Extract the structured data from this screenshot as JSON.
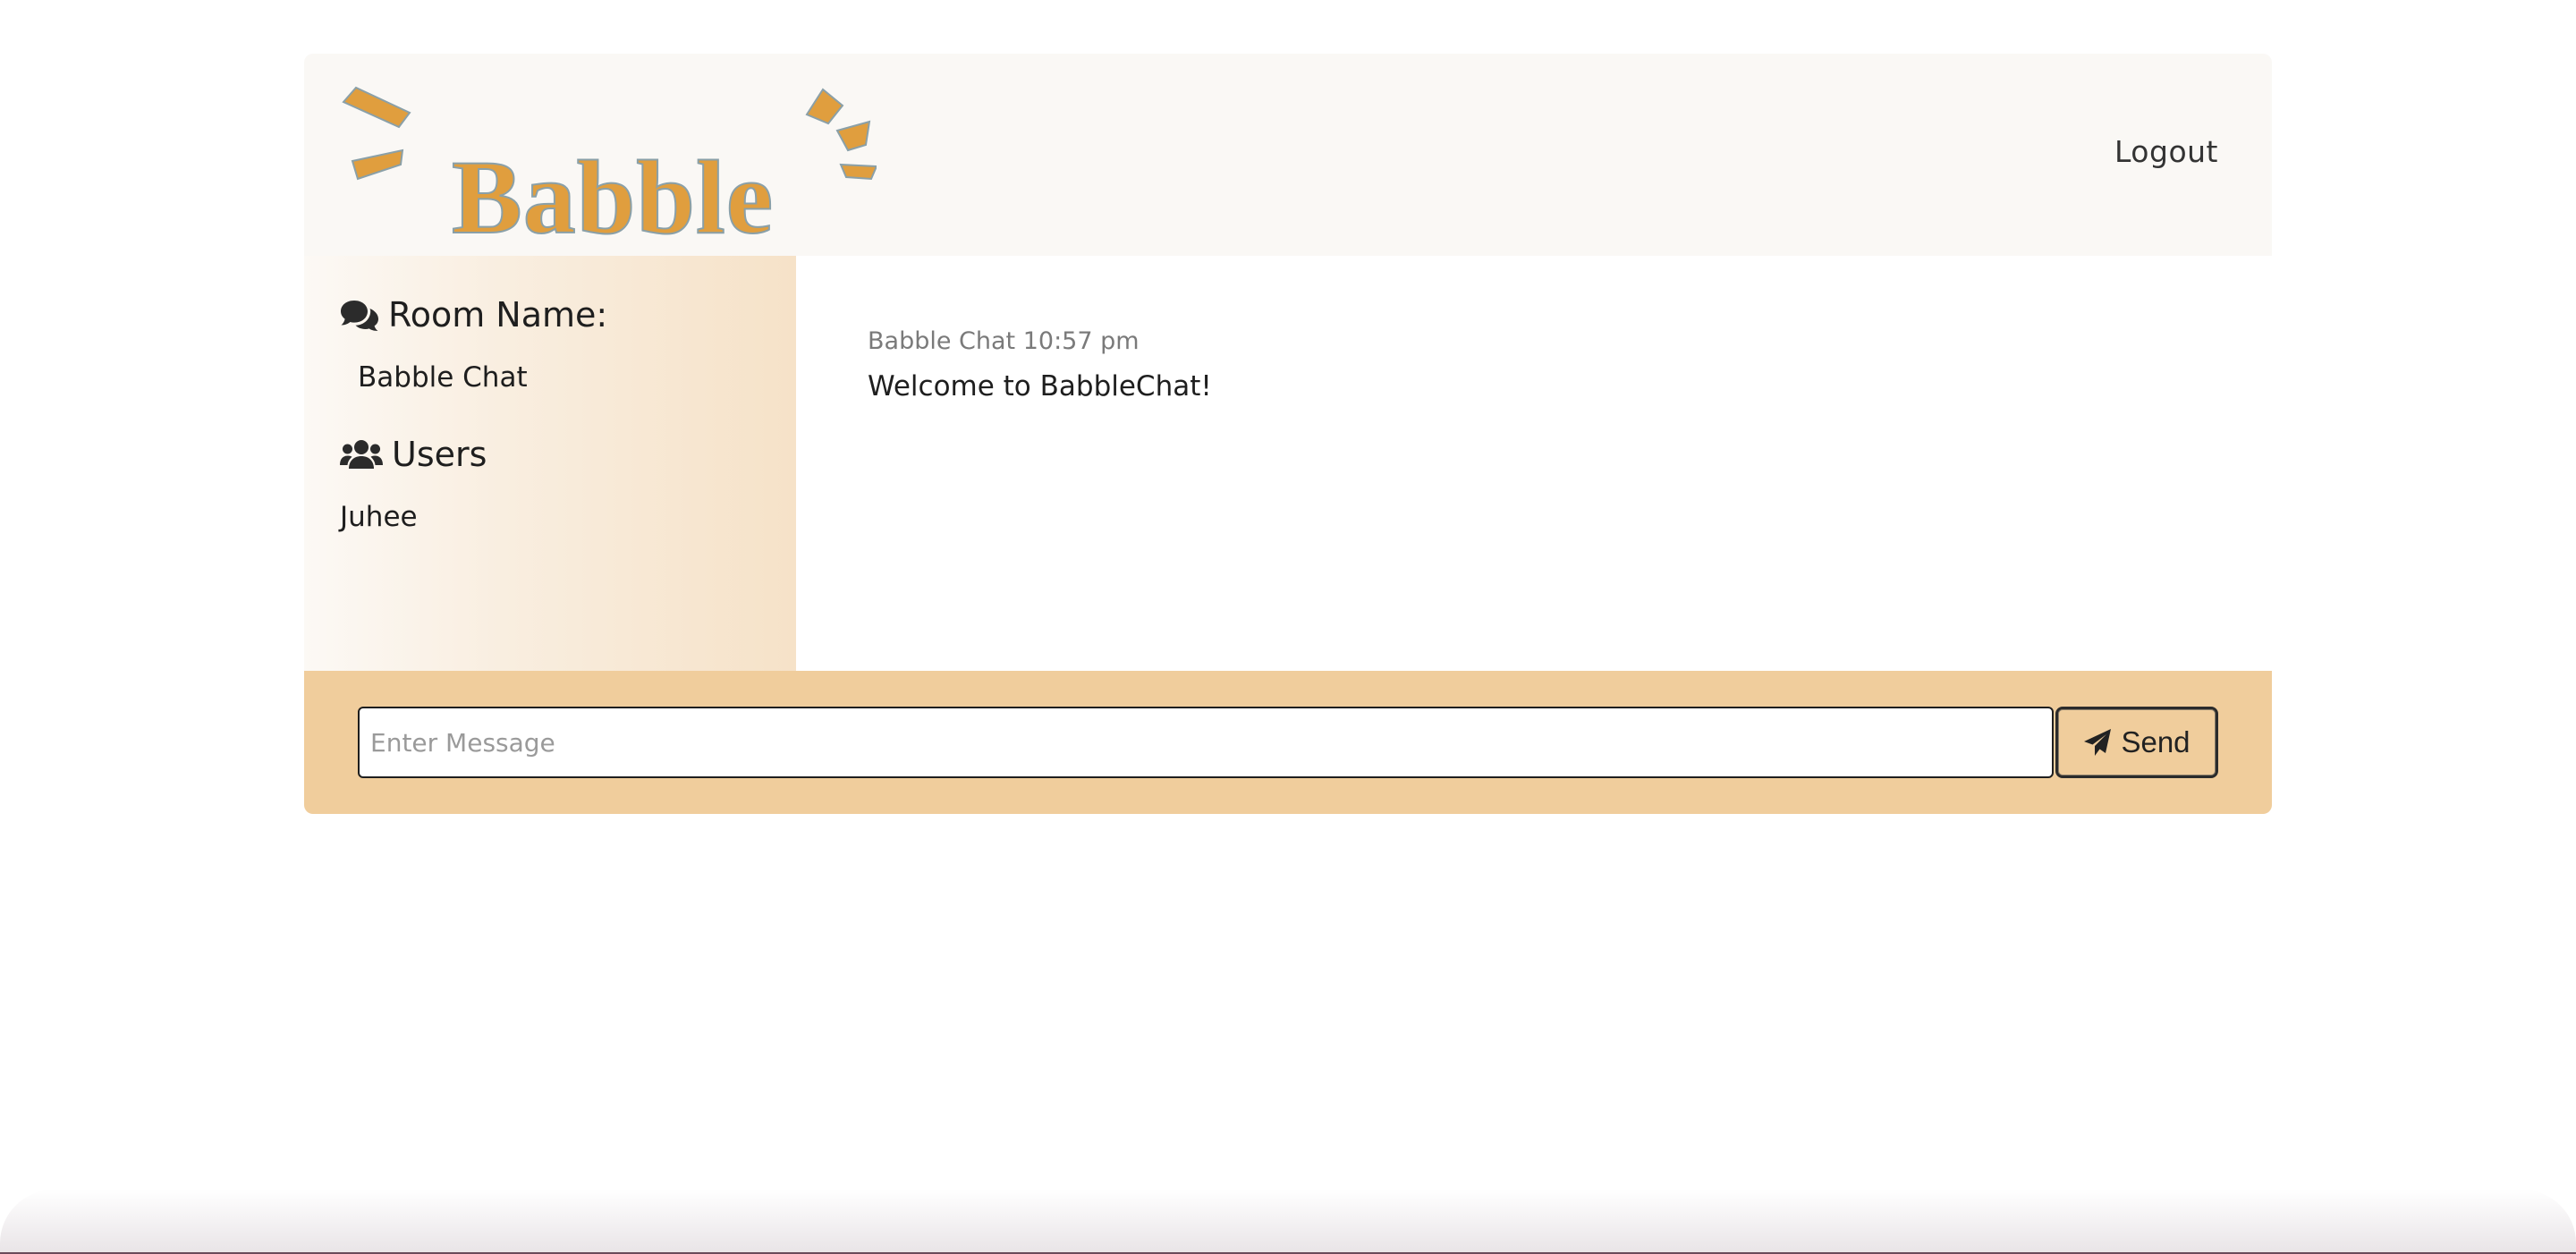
{
  "app": {
    "logo_text": "Babble",
    "brand_color": "#e09e3e",
    "logout_label": "Logout"
  },
  "sidebar": {
    "room_heading": "Room Name:",
    "room_icon": "comments-icon",
    "room_name": "Babble Chat",
    "users_heading": "Users",
    "users_icon": "users-icon",
    "users": [
      "Juhee"
    ]
  },
  "chat": {
    "messages": [
      {
        "meta": "Babble Chat 10:57 pm",
        "text": "Welcome to BabbleChat!"
      }
    ]
  },
  "composer": {
    "placeholder": "Enter Message",
    "value": "",
    "send_label": "Send",
    "send_icon": "paper-plane-icon",
    "background_color": "#f0cd9c"
  }
}
